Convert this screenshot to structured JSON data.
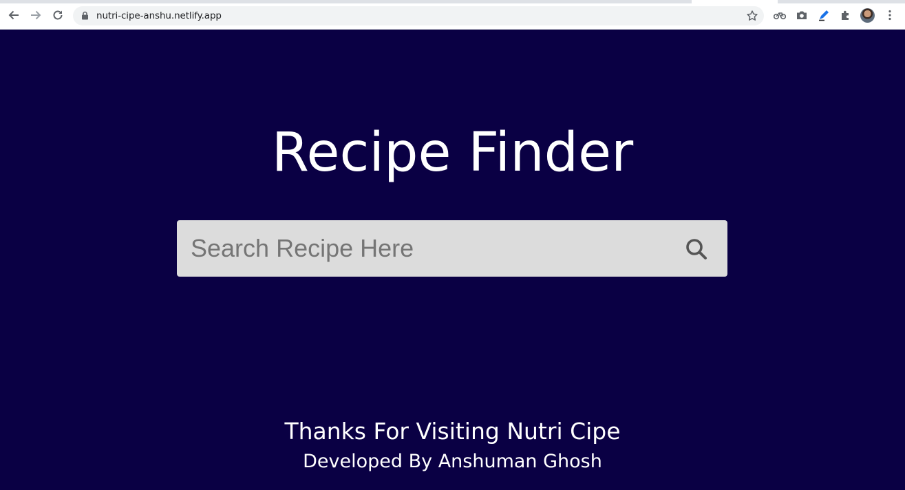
{
  "browser": {
    "url": "nutri-cipe-anshu.netlify.app",
    "icons": {
      "back": "arrow-left-icon",
      "forward": "arrow-right-icon",
      "reload": "reload-icon",
      "lock": "lock-icon",
      "bookmark": "star-icon",
      "extensions": [
        "bicycle-extension-icon",
        "camera-extension-icon",
        "highlighter-extension-icon",
        "puzzle-extensions-icon"
      ],
      "profile": "avatar",
      "menu": "kebab-menu-icon"
    }
  },
  "page": {
    "background_color": "#0a0044",
    "title": "Recipe Finder",
    "search": {
      "placeholder": "Search Recipe Here",
      "value": "",
      "button_icon": "search-icon"
    },
    "footer": {
      "thanks": "Thanks For Visiting Nutri Cipe",
      "credit": "Developed By Anshuman Ghosh"
    }
  }
}
